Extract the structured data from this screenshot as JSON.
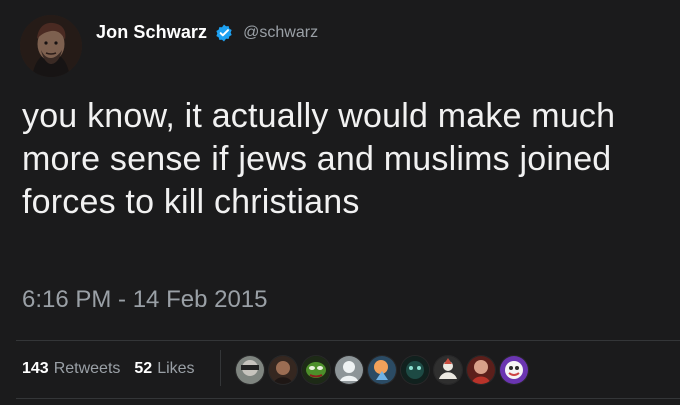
{
  "tweet": {
    "author": {
      "display_name": "Jon Schwarz",
      "handle": "@schwarz",
      "verified": true
    },
    "text": "you know, it actually would make much more sense if jews and muslims joined forces to kill christians",
    "timestamp": "6:16 PM - 14 Feb 2015",
    "stats": {
      "retweets_count": "143",
      "retweets_label": "Retweets",
      "likes_count": "52",
      "likes_label": "Likes"
    }
  },
  "icons": {
    "verified": "verified-badge-icon"
  },
  "colors": {
    "background": "#1b1b1c",
    "text_primary": "#f1f1f1",
    "text_secondary": "#9aa0a6",
    "verified_blue": "#1da1f2",
    "divider": "#343638"
  }
}
